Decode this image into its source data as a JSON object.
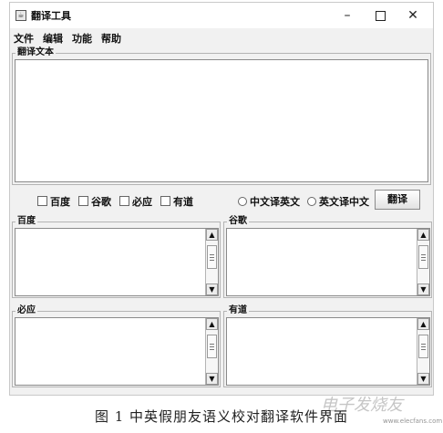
{
  "window": {
    "title": "翻译工具",
    "controls": {
      "minimize": "–",
      "close": "✕"
    }
  },
  "menu": [
    "文件",
    "编辑",
    "功能",
    "帮助"
  ],
  "source_panel": {
    "title": "翻译文本",
    "text": ""
  },
  "engines": [
    {
      "label": "百度",
      "checked": false
    },
    {
      "label": "谷歌",
      "checked": false
    },
    {
      "label": "必应",
      "checked": false
    },
    {
      "label": "有道",
      "checked": false
    }
  ],
  "directions": [
    {
      "label": "中文译英文",
      "selected": false
    },
    {
      "label": "英文译中文",
      "selected": false
    }
  ],
  "translate_button": "翻译",
  "result_panels": [
    {
      "title": "百度",
      "text": ""
    },
    {
      "title": "谷歌",
      "text": ""
    },
    {
      "title": "必应",
      "text": ""
    },
    {
      "title": "有道",
      "text": ""
    }
  ],
  "scroll": {
    "up": "▲",
    "down": "▼"
  },
  "caption": "图 1   中英假朋友语义校对翻译软件界面",
  "watermark": "电子发烧友",
  "watermark_url": "www.elecfans.com"
}
